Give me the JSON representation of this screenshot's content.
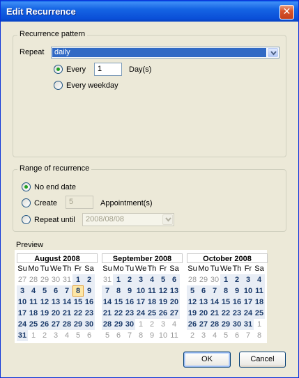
{
  "window": {
    "title": "Edit Recurrence",
    "close_glyph": "✕"
  },
  "recurrence_pattern": {
    "legend": "Recurrence pattern",
    "repeat_label": "Repeat",
    "repeat_value": "daily",
    "every_label": "Every",
    "every_value": "1",
    "days_unit": "Day(s)",
    "every_weekday_label": "Every weekday",
    "selected_option": "every"
  },
  "range": {
    "legend": "Range of recurrence",
    "no_end_date_label": "No end date",
    "create_label": "Create",
    "create_value": "5",
    "appointments_unit": "Appointment(s)",
    "repeat_until_label": "Repeat until",
    "repeat_until_value": "2008/08/08",
    "selected_option": "no_end_date"
  },
  "preview": {
    "label": "Preview",
    "weekdays": [
      "Su",
      "Mo",
      "Tu",
      "We",
      "Th",
      "Fr",
      "Sa"
    ],
    "months": [
      {
        "title": "August 2008",
        "dates": [
          {
            "d": "27",
            "t": "other"
          },
          {
            "d": "28",
            "t": "other"
          },
          {
            "d": "29",
            "t": "other"
          },
          {
            "d": "30",
            "t": "other"
          },
          {
            "d": "31",
            "t": "other"
          },
          {
            "d": "1",
            "t": "cur"
          },
          {
            "d": "2",
            "t": "cur"
          },
          {
            "d": "3",
            "t": "cur"
          },
          {
            "d": "4",
            "t": "cur"
          },
          {
            "d": "5",
            "t": "cur"
          },
          {
            "d": "6",
            "t": "cur"
          },
          {
            "d": "7",
            "t": "cur"
          },
          {
            "d": "8",
            "t": "today"
          },
          {
            "d": "9",
            "t": "cur"
          },
          {
            "d": "10",
            "t": "cur"
          },
          {
            "d": "11",
            "t": "cur"
          },
          {
            "d": "12",
            "t": "cur"
          },
          {
            "d": "13",
            "t": "cur"
          },
          {
            "d": "14",
            "t": "cur"
          },
          {
            "d": "15",
            "t": "cur"
          },
          {
            "d": "16",
            "t": "cur"
          },
          {
            "d": "17",
            "t": "cur"
          },
          {
            "d": "18",
            "t": "cur"
          },
          {
            "d": "19",
            "t": "cur"
          },
          {
            "d": "20",
            "t": "cur"
          },
          {
            "d": "21",
            "t": "cur"
          },
          {
            "d": "22",
            "t": "cur"
          },
          {
            "d": "23",
            "t": "cur"
          },
          {
            "d": "24",
            "t": "cur"
          },
          {
            "d": "25",
            "t": "cur"
          },
          {
            "d": "26",
            "t": "cur"
          },
          {
            "d": "27",
            "t": "cur"
          },
          {
            "d": "28",
            "t": "cur"
          },
          {
            "d": "29",
            "t": "cur"
          },
          {
            "d": "30",
            "t": "cur"
          },
          {
            "d": "31",
            "t": "cur"
          },
          {
            "d": "1",
            "t": "other"
          },
          {
            "d": "2",
            "t": "other"
          },
          {
            "d": "3",
            "t": "other"
          },
          {
            "d": "4",
            "t": "other"
          },
          {
            "d": "5",
            "t": "other"
          },
          {
            "d": "6",
            "t": "other"
          }
        ]
      },
      {
        "title": "September 2008",
        "dates": [
          {
            "d": "31",
            "t": "other"
          },
          {
            "d": "1",
            "t": "cur"
          },
          {
            "d": "2",
            "t": "cur"
          },
          {
            "d": "3",
            "t": "cur"
          },
          {
            "d": "4",
            "t": "cur"
          },
          {
            "d": "5",
            "t": "cur"
          },
          {
            "d": "6",
            "t": "cur"
          },
          {
            "d": "7",
            "t": "cur"
          },
          {
            "d": "8",
            "t": "cur"
          },
          {
            "d": "9",
            "t": "cur"
          },
          {
            "d": "10",
            "t": "cur"
          },
          {
            "d": "11",
            "t": "cur"
          },
          {
            "d": "12",
            "t": "cur"
          },
          {
            "d": "13",
            "t": "cur"
          },
          {
            "d": "14",
            "t": "cur"
          },
          {
            "d": "15",
            "t": "cur"
          },
          {
            "d": "16",
            "t": "cur"
          },
          {
            "d": "17",
            "t": "cur"
          },
          {
            "d": "18",
            "t": "cur"
          },
          {
            "d": "19",
            "t": "cur"
          },
          {
            "d": "20",
            "t": "cur"
          },
          {
            "d": "21",
            "t": "cur"
          },
          {
            "d": "22",
            "t": "cur"
          },
          {
            "d": "23",
            "t": "cur"
          },
          {
            "d": "24",
            "t": "cur"
          },
          {
            "d": "25",
            "t": "cur"
          },
          {
            "d": "26",
            "t": "cur"
          },
          {
            "d": "27",
            "t": "cur"
          },
          {
            "d": "28",
            "t": "cur"
          },
          {
            "d": "29",
            "t": "cur"
          },
          {
            "d": "30",
            "t": "cur"
          },
          {
            "d": "1",
            "t": "other"
          },
          {
            "d": "2",
            "t": "other"
          },
          {
            "d": "3",
            "t": "other"
          },
          {
            "d": "4",
            "t": "other"
          },
          {
            "d": "5",
            "t": "other"
          },
          {
            "d": "6",
            "t": "other"
          },
          {
            "d": "7",
            "t": "other"
          },
          {
            "d": "8",
            "t": "other"
          },
          {
            "d": "9",
            "t": "other"
          },
          {
            "d": "10",
            "t": "other"
          },
          {
            "d": "11",
            "t": "other"
          }
        ]
      },
      {
        "title": "October 2008",
        "dates": [
          {
            "d": "28",
            "t": "other"
          },
          {
            "d": "29",
            "t": "other"
          },
          {
            "d": "30",
            "t": "other"
          },
          {
            "d": "1",
            "t": "cur"
          },
          {
            "d": "2",
            "t": "cur"
          },
          {
            "d": "3",
            "t": "cur"
          },
          {
            "d": "4",
            "t": "cur"
          },
          {
            "d": "5",
            "t": "cur"
          },
          {
            "d": "6",
            "t": "cur"
          },
          {
            "d": "7",
            "t": "cur"
          },
          {
            "d": "8",
            "t": "cur"
          },
          {
            "d": "9",
            "t": "cur"
          },
          {
            "d": "10",
            "t": "cur"
          },
          {
            "d": "11",
            "t": "cur"
          },
          {
            "d": "12",
            "t": "cur"
          },
          {
            "d": "13",
            "t": "cur"
          },
          {
            "d": "14",
            "t": "cur"
          },
          {
            "d": "15",
            "t": "cur"
          },
          {
            "d": "16",
            "t": "cur"
          },
          {
            "d": "17",
            "t": "cur"
          },
          {
            "d": "18",
            "t": "cur"
          },
          {
            "d": "19",
            "t": "cur"
          },
          {
            "d": "20",
            "t": "cur"
          },
          {
            "d": "21",
            "t": "cur"
          },
          {
            "d": "22",
            "t": "cur"
          },
          {
            "d": "23",
            "t": "cur"
          },
          {
            "d": "24",
            "t": "cur"
          },
          {
            "d": "25",
            "t": "cur"
          },
          {
            "d": "26",
            "t": "cur"
          },
          {
            "d": "27",
            "t": "cur"
          },
          {
            "d": "28",
            "t": "cur"
          },
          {
            "d": "29",
            "t": "cur"
          },
          {
            "d": "30",
            "t": "cur"
          },
          {
            "d": "31",
            "t": "cur"
          },
          {
            "d": "1",
            "t": "other"
          },
          {
            "d": "2",
            "t": "other"
          },
          {
            "d": "3",
            "t": "other"
          },
          {
            "d": "4",
            "t": "other"
          },
          {
            "d": "5",
            "t": "other"
          },
          {
            "d": "6",
            "t": "other"
          },
          {
            "d": "7",
            "t": "other"
          },
          {
            "d": "8",
            "t": "other"
          }
        ]
      }
    ]
  },
  "buttons": {
    "ok": "OK",
    "cancel": "Cancel"
  },
  "colors": {
    "accent": "#316ac5",
    "titlebar": "#0a4fd8",
    "today_bg": "#fde7a6",
    "radio_dot": "#21a121"
  }
}
